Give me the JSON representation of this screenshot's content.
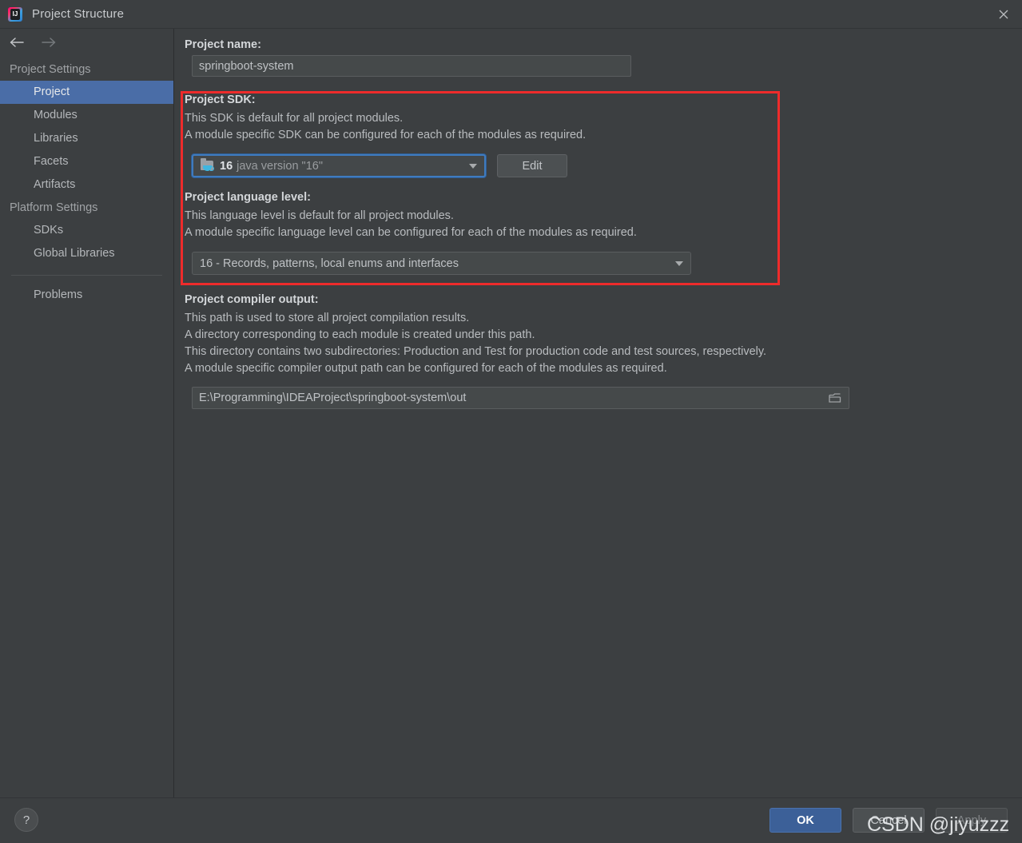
{
  "window": {
    "title": "Project Structure",
    "app_icon": "intellij-idea-icon",
    "close_icon": "close-icon"
  },
  "sidebar": {
    "back_icon": "arrow-left-icon",
    "forward_icon": "arrow-right-icon",
    "groups": [
      {
        "label": "Project Settings",
        "items": [
          {
            "label": "Project",
            "selected": true
          },
          {
            "label": "Modules",
            "selected": false
          },
          {
            "label": "Libraries",
            "selected": false
          },
          {
            "label": "Facets",
            "selected": false
          },
          {
            "label": "Artifacts",
            "selected": false
          }
        ]
      },
      {
        "label": "Platform Settings",
        "items": [
          {
            "label": "SDKs",
            "selected": false
          },
          {
            "label": "Global Libraries",
            "selected": false
          }
        ]
      }
    ],
    "extra_items": [
      {
        "label": "Problems",
        "selected": false
      }
    ]
  },
  "main": {
    "project_name": {
      "label": "Project name:",
      "value": "springboot-system"
    },
    "project_sdk": {
      "label": "Project SDK:",
      "desc_line_1": "This SDK is default for all project modules.",
      "desc_line_2": "A module specific SDK can be configured for each of the modules as required.",
      "sdk_icon": "java-sdk-folder-icon",
      "version": "16",
      "description": "java version \"16\"",
      "dropdown_icon": "chevron-down-icon",
      "edit_button": "Edit"
    },
    "language_level": {
      "label": "Project language level:",
      "desc_line_1": "This language level is default for all project modules.",
      "desc_line_2": "A module specific language level can be configured for each of the modules as required.",
      "value": "16 - Records, patterns, local enums and interfaces",
      "dropdown_icon": "chevron-down-icon"
    },
    "compiler_output": {
      "label": "Project compiler output:",
      "desc_line_1": "This path is used to store all project compilation results.",
      "desc_line_2": "A directory corresponding to each module is created under this path.",
      "desc_line_3": "This directory contains two subdirectories: Production and Test for production code and test sources, respectively.",
      "desc_line_4": "A module specific compiler output path can be configured for each of the modules as required.",
      "path": "E:\\Programming\\IDEAProject\\springboot-system\\out",
      "browse_icon": "folder-browse-icon"
    }
  },
  "footer": {
    "help_label": "?",
    "ok_label": "OK",
    "cancel_label": "Cancel",
    "apply_label": "Apply"
  },
  "annotation": {
    "highlight_color": "#ee2b2b",
    "watermark_text": "CSDN @jiyuzzz"
  },
  "colors": {
    "window_bg": "#3c3f41",
    "selection_blue": "#4a6da7",
    "focus_blue": "#3f7bbf",
    "primary_button": "#3c6098",
    "java_cup": "#3fb6e0"
  }
}
